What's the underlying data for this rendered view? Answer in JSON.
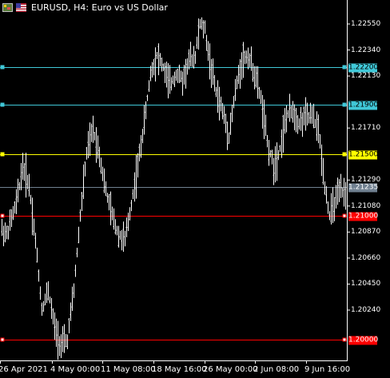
{
  "header": {
    "title": "EURUSD, H4:  Euro vs US Dollar",
    "icons": [
      "chart-settings-icon",
      "flag-icon"
    ]
  },
  "price_axis": {
    "ticks": [
      "1.22550",
      "1.22340",
      "1.22130",
      "1.21710",
      "1.21290",
      "1.21080",
      "1.20870",
      "1.20660",
      "1.20450",
      "1.20240"
    ]
  },
  "time_axis": {
    "labels": [
      "26 Apr 2021",
      "4 May 00:00",
      "11 May 08:00",
      "18 May 16:00",
      "26 May 00:00",
      "2 Jun 08:00",
      "9 Jun 16:00"
    ]
  },
  "levels": [
    {
      "label": "1.22200",
      "price": 1.222,
      "line_color": "#40c8d8",
      "tag_bg": "#40c8d8",
      "tag_text": "#000000"
    },
    {
      "label": "1.21900",
      "price": 1.219,
      "line_color": "#40c8d8",
      "tag_bg": "#40c8d8",
      "tag_text": "#000000"
    },
    {
      "label": "1.21500",
      "price": 1.215,
      "line_color": "#ffff00",
      "tag_bg": "#ffff00",
      "tag_text": "#000000"
    },
    {
      "label": "1.21235",
      "price": 1.21235,
      "line_color": "#708090",
      "tag_bg": "#708090",
      "tag_text": "#ffffff"
    },
    {
      "label": "1.21000",
      "price": 1.21,
      "line_color": "#ff0000",
      "tag_bg": "#ff0000",
      "tag_text": "#ffffff"
    },
    {
      "label": "1.20000",
      "price": 1.2,
      "line_color": "#ff0000",
      "tag_bg": "#ff0000",
      "tag_text": "#ffffff"
    }
  ],
  "chart_data": {
    "type": "line",
    "title": "EURUSD, H4:  Euro vs US Dollar",
    "series": [
      {
        "name": "EURUSD",
        "x": [
          "26 Apr 2021",
          "4 May 00:00",
          "11 May 08:00",
          "18 May 16:00",
          "26 May 00:00",
          "2 Jun 08:00",
          "9 Jun 16:00"
        ],
        "values": [
          1.209,
          1.204,
          1.21,
          1.219,
          1.222,
          1.216,
          1.211
        ]
      }
    ],
    "ylim": [
      1.1985,
      1.2275
    ],
    "grid": false,
    "colors": {
      "bars": "#ffffff",
      "background": "#000000",
      "axis": "#ffffff"
    }
  }
}
